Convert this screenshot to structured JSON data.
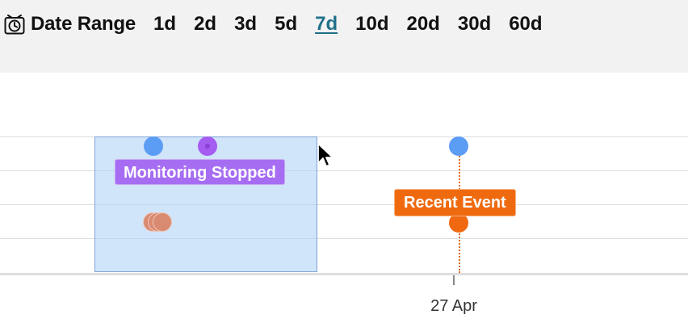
{
  "date_range": {
    "icon": "alarm-clock-icon",
    "label": "Date Range",
    "options": [
      "1d",
      "2d",
      "3d",
      "5d",
      "7d",
      "10d",
      "20d",
      "30d",
      "60d"
    ],
    "selected": "7d"
  },
  "timeline": {
    "events": [
      {
        "label": "Monitoring Stopped",
        "color": "#a66df3"
      },
      {
        "label": "Recent Event",
        "color": "#ef6a0f"
      }
    ],
    "tick_label": "27 Apr"
  },
  "colors": {
    "selection_fill": "#aacdf5",
    "blue_dot": "#5b9cf5",
    "purple_dot": "#a45df0",
    "salmon_dot": "#d98b72",
    "orange_dot": "#f0680f",
    "selected_link": "#1f6f8b"
  }
}
